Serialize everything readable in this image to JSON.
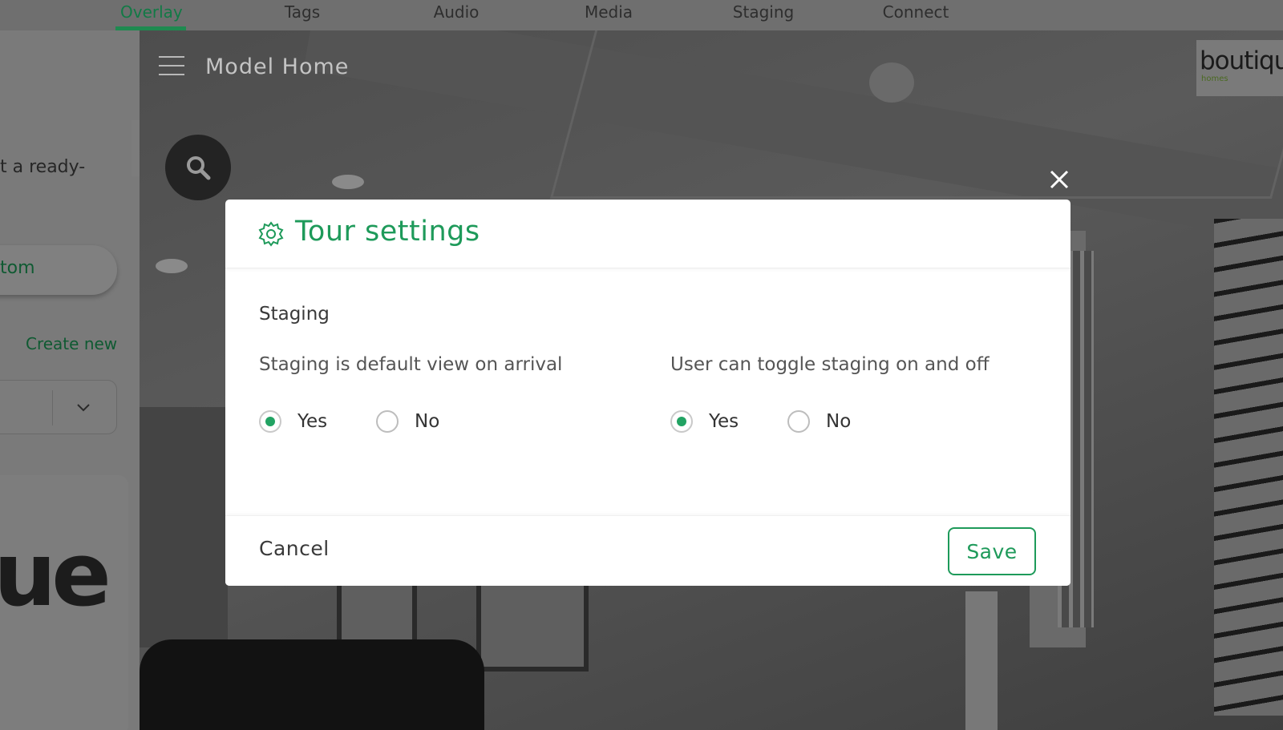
{
  "tabs": [
    {
      "label": "Overlay",
      "active": true
    },
    {
      "label": "Tags",
      "active": false
    },
    {
      "label": "Audio",
      "active": false
    },
    {
      "label": "Media",
      "active": false
    },
    {
      "label": "Staging",
      "active": false
    },
    {
      "label": "Connect",
      "active": false
    }
  ],
  "left_panel": {
    "partial_text": "t a ready-",
    "pill_label": "tom",
    "create_new_label": "Create new",
    "card_text": "ue"
  },
  "viewer": {
    "title": "Model Home",
    "logo_text": "boutiqu",
    "logo_subtext": "homes"
  },
  "modal": {
    "title": "Tour settings",
    "section": "Staging",
    "question_1": "Staging is default view on arrival",
    "question_2": "User can toggle staging on and off",
    "q1_options": [
      {
        "label": "Yes",
        "checked": true
      },
      {
        "label": "No",
        "checked": false
      }
    ],
    "q2_options": [
      {
        "label": "Yes",
        "checked": true
      },
      {
        "label": "No",
        "checked": false
      }
    ],
    "cancel_label": "Cancel",
    "save_label": "Save"
  },
  "colors": {
    "accent": "#1e9a5a",
    "radio_dot": "#22a363",
    "overlay_dim": "#5a5a5a"
  },
  "icons": [
    "menu-icon",
    "search-icon",
    "chevron-left-icon",
    "chevron-down-icon",
    "gear-icon",
    "close-icon"
  ]
}
